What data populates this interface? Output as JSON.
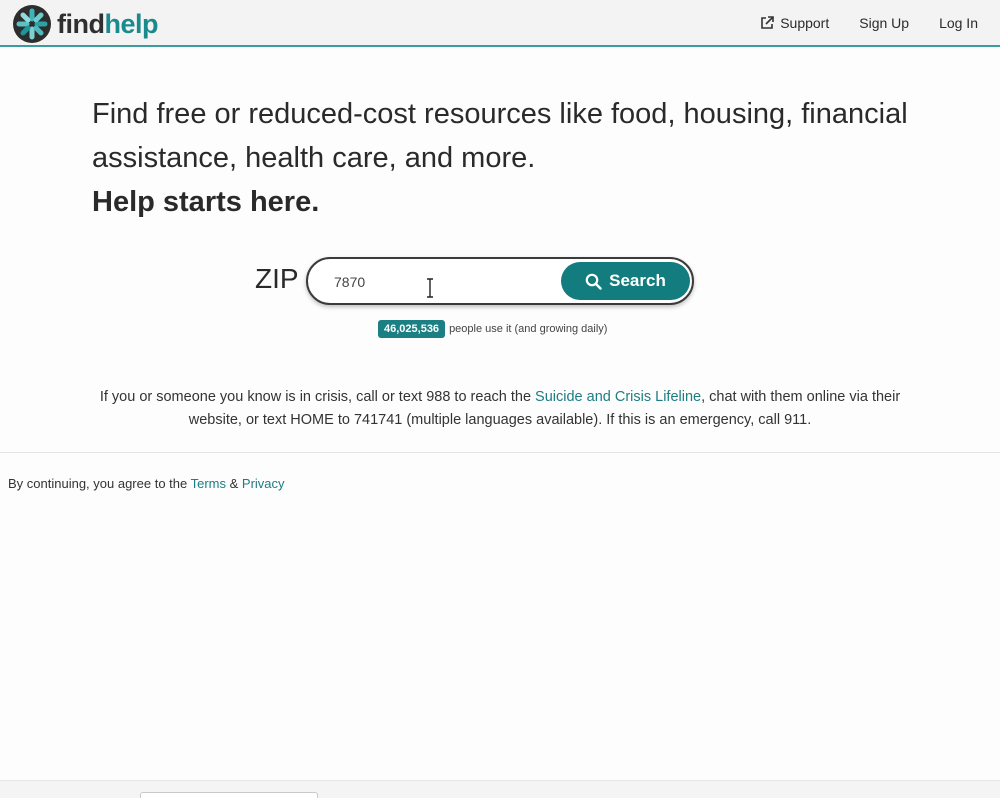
{
  "header": {
    "logo": {
      "find": "find",
      "help": "help"
    },
    "nav": {
      "support": "Support",
      "sign_up": "Sign Up",
      "log_in": "Log In"
    },
    "icons": {
      "logo": "findhelp-logo-icon",
      "support": "external-link-icon"
    }
  },
  "hero": {
    "line1": "Find free or reduced-cost resources like food, housing, financial",
    "line2": "assistance, health care, and more.",
    "tagline": "Help starts here."
  },
  "search": {
    "zip_label": "ZIP",
    "zip_value": "7870",
    "button_label": "Search",
    "button_icon": "search-icon"
  },
  "stats": {
    "count": "46,025,536",
    "text": "people use it (and growing daily)"
  },
  "crisis": {
    "text_before": "If you or someone you know is in crisis, call or text 988 to reach the ",
    "link": "Suicide and Crisis Lifeline",
    "text_after": ", chat with them online via their website, or text HOME to 741741 (multiple languages available). If this is an emergency, call 911."
  },
  "footer": {
    "prefix": "By continuing, you agree to the ",
    "terms": "Terms",
    "amp": " & ",
    "privacy": "Privacy"
  },
  "colors": {
    "brand_teal": "#137c7e",
    "header_border": "#3a9c9f",
    "link": "#1d7d82"
  }
}
